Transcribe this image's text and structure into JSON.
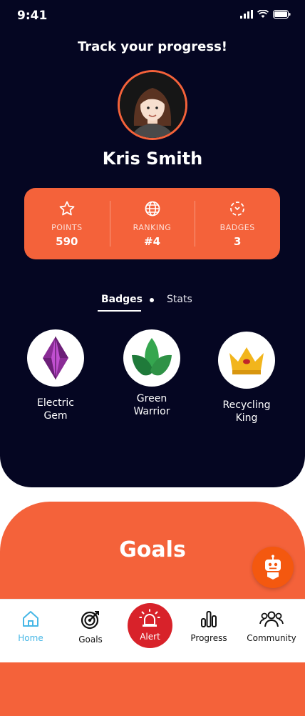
{
  "status_bar": {
    "time": "9:41"
  },
  "header": {
    "title": "Track your progress!"
  },
  "profile": {
    "name": "Kris Smith"
  },
  "stats": [
    {
      "label": "POINTS",
      "value": "590",
      "icon": "star-icon"
    },
    {
      "label": "RANKING",
      "value": "#4",
      "icon": "globe-icon"
    },
    {
      "label": "BADGES",
      "value": "3",
      "icon": "badge-icon"
    }
  ],
  "tabs": {
    "badges": "Badges",
    "stats": "Stats",
    "active": "Badges"
  },
  "badges": [
    {
      "line1": "Electric",
      "line2": "Gem",
      "icon": "gem-icon"
    },
    {
      "line1": "Green",
      "line2": "Warrior",
      "icon": "leaf-icon"
    },
    {
      "line1": "Recycling",
      "line2": "King",
      "icon": "crown-icon"
    }
  ],
  "goals": {
    "title": "Goals"
  },
  "nav": {
    "home": "Home",
    "goals": "Goals",
    "alert": "Alert",
    "progress": "Progress",
    "community": "Community"
  },
  "colors": {
    "background_dark": "#050622",
    "accent_orange": "#f4623a",
    "alert_red": "#d8222a",
    "active_nav": "#47b7e6"
  }
}
